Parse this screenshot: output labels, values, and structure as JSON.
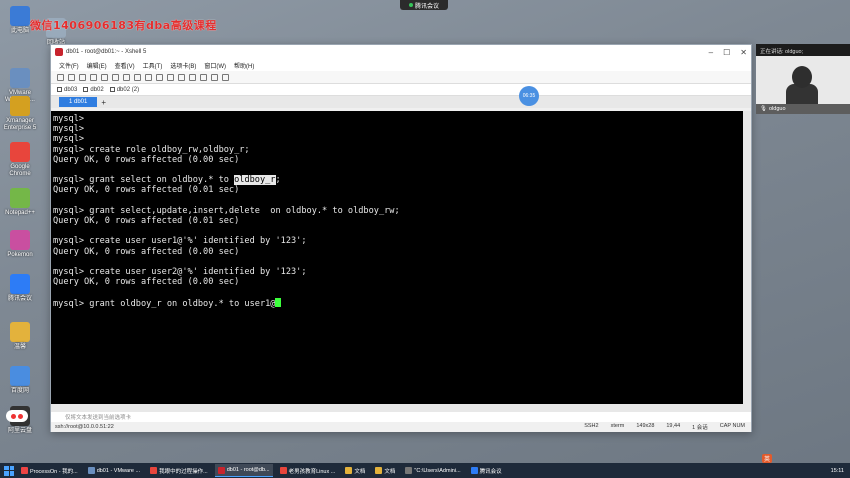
{
  "watermark": "微信1406906183有dba高级课程",
  "meeting_indicator": "腾讯会议",
  "desktop_icons": [
    {
      "label": "此电脑",
      "color": "#3b7bd6"
    },
    {
      "label": "回收站",
      "color": "#9ab"
    },
    {
      "label": "VMware Workstati...",
      "color": "#6a8fbf"
    },
    {
      "label": "Xmanager Enterprise 5",
      "color": "#d4a020"
    },
    {
      "label": "Google Chrome",
      "color": "#e8453c"
    },
    {
      "label": "Notepad++",
      "color": "#74b748"
    },
    {
      "label": "Pokemon",
      "color": "#c94fa0"
    },
    {
      "label": "腾讯会议",
      "color": "#2d7cf6"
    },
    {
      "label": "温馨",
      "color": "#e3b23c"
    },
    {
      "label": "百度网",
      "color": "#4a8de0"
    },
    {
      "label": "阿里云盘",
      "color": "#333"
    }
  ],
  "window": {
    "title": "db01 - root@db01:~ - Xshell 5",
    "menu": [
      "文件(F)",
      "编辑(E)",
      "查看(V)",
      "工具(T)",
      "选项卡(B)",
      "窗口(W)",
      "帮助(H)"
    ],
    "sessions": [
      "db03",
      "db02",
      "db02 (2)"
    ],
    "active_tab": "1 db01",
    "timer": "06:35"
  },
  "terminal": {
    "lines": [
      "mysql>",
      "mysql>",
      "mysql>",
      "mysql> create role oldboy_rw,oldboy_r;",
      "Query OK, 0 rows affected (0.00 sec)",
      "",
      "mysql> grant select on oldboy.* to ",
      "Query OK, 0 rows affected (0.01 sec)",
      "",
      "mysql> grant select,update,insert,delete  on oldboy.* to oldboy_rw;",
      "Query OK, 0 rows affected (0.01 sec)",
      "",
      "mysql> create user user1@'%' identified by '123';",
      "Query OK, 0 rows affected (0.00 sec)",
      "",
      "mysql> create user user2@'%' identified by '123';",
      "Query OK, 0 rows affected (0.00 sec)",
      "",
      "mysql> grant oldboy_r on oldboy.* to user1@"
    ],
    "highlight_text": "oldboy_r",
    "highlight_tail": ";"
  },
  "cmd_placeholder": "仅将文本发送到当前选项卡",
  "status": {
    "left": "ssh://root@10.0.0.51:22",
    "protocol": "SSH2",
    "term": "xterm",
    "size": "149x28",
    "pos": "19,44",
    "sessions": "1 会话",
    "caps": "CAP NUM"
  },
  "speaker": {
    "header": "正在讲话: oldguo;",
    "name": "oldguo"
  },
  "taskbar": {
    "items": [
      {
        "label": "ProcessOn - 我的...",
        "color": "#e44"
      },
      {
        "label": "db01 - VMware ...",
        "color": "#6a8fbf"
      },
      {
        "label": "我眼中的过程操作...",
        "color": "#e8453c"
      },
      {
        "label": "db01 - root@db...",
        "color": "#c8242d",
        "active": true
      },
      {
        "label": "老男孩教育Linux ...",
        "color": "#e8453c"
      },
      {
        "label": "文档",
        "color": "#e3b23c"
      },
      {
        "label": "文档",
        "color": "#e3b23c"
      },
      {
        "label": "\"C:\\Users\\Admini...",
        "color": "#777"
      },
      {
        "label": "腾讯会议",
        "color": "#2d7cf6"
      }
    ],
    "clock": "15:11",
    "ime": "英"
  }
}
